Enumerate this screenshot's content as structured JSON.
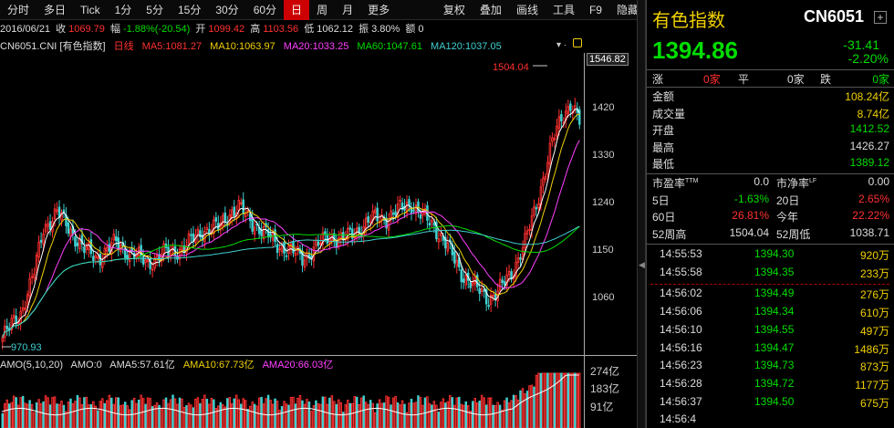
{
  "toolbar": {
    "items": [
      "分时",
      "多日",
      "Tick",
      "1分",
      "5分",
      "15分",
      "30分",
      "60分",
      "日",
      "周",
      "月",
      "更多"
    ],
    "active_index": 8,
    "right_items": [
      "复权",
      "叠加",
      "画线",
      "工具",
      "F9",
      "隐藏"
    ]
  },
  "info": {
    "date": "2016/06/21",
    "close_label": "收",
    "close": "1069.79",
    "change_label": "幅",
    "change": "-1.88%(-20.54)",
    "open_label": "开",
    "open": "1099.42",
    "high_label": "高",
    "high": "1103.56",
    "low_label": "低",
    "low": "1062.12",
    "amp_label": "振",
    "amp": "3.80%",
    "vol_label": "额",
    "vol": "0"
  },
  "ma": {
    "title": "CN6051.CNI [有色指数]",
    "period": "日线",
    "ma5": "MA5:1081.27",
    "ma10": "MA10:1063.97",
    "ma20": "MA20:1033.25",
    "ma60": "MA60:1047.61",
    "ma120": "MA120:1037.05"
  },
  "colors": {
    "ma5": "#ffffff",
    "ma10": "#f0d000",
    "ma20": "#ff40ff",
    "ma60": "#00dd00",
    "ma120": "#40d0d0",
    "up": "#ff3030",
    "down": "#40d0d0"
  },
  "chart_labels": {
    "high_annot": "1504.04",
    "low_annot": "970.93",
    "top_value": "1546.82",
    "yticks": [
      "1420",
      "1330",
      "1240",
      "1150",
      "1060"
    ]
  },
  "amo": {
    "label": "AMO(5,10,20)",
    "amo": "AMO:0",
    "ama5": "AMA5:57.61亿",
    "ama10": "AMA10:67.73亿",
    "ama20": "AMA20:66.03亿",
    "yticks": [
      "274亿",
      "183亿",
      "91亿"
    ]
  },
  "panel": {
    "name": "有色指数",
    "code": "CN6051",
    "price": "1394.86",
    "change": "-31.41",
    "pct": "-2.20%",
    "adv": {
      "up_label": "涨",
      "up": "0家",
      "flat_label": "平",
      "flat": "0家",
      "down_label": "跌",
      "down": "0家"
    },
    "stats": [
      {
        "k": "金额",
        "v": "108.24亿",
        "c": "yellow"
      },
      {
        "k": "成交量",
        "v": "8.74亿",
        "c": "yellow"
      },
      {
        "k": "开盘",
        "v": "1412.52",
        "c": "green"
      },
      {
        "k": "最高",
        "v": "1426.27",
        "c": "white"
      },
      {
        "k": "最低",
        "v": "1389.12",
        "c": "green"
      }
    ],
    "ratios": [
      {
        "k1": "市盈率",
        "sup1": "TTM",
        "v1": "0.0",
        "c1": "white",
        "k2": "市净率",
        "sup2": "LF",
        "v2": "0.00",
        "c2": "white"
      },
      {
        "k1": "5日",
        "v1": "-1.63%",
        "c1": "green",
        "k2": "20日",
        "v2": "2.65%",
        "c2": "red"
      },
      {
        "k1": "60日",
        "v1": "26.81%",
        "c1": "red",
        "k2": "今年",
        "v2": "22.22%",
        "c2": "red"
      },
      {
        "k1": "52周高",
        "v1": "1504.04",
        "c1": "white",
        "k2": "52周低",
        "v2": "1038.71",
        "c2": "white"
      }
    ],
    "ticks": [
      {
        "t": "14:55:53",
        "p": "1394.30",
        "v": "920万"
      },
      {
        "t": "14:55:58",
        "p": "1394.35",
        "v": "233万"
      },
      {
        "t": "14:56:02",
        "p": "1394.49",
        "v": "276万"
      },
      {
        "t": "14:56:06",
        "p": "1394.34",
        "v": "610万"
      },
      {
        "t": "14:56:10",
        "p": "1394.55",
        "v": "497万"
      },
      {
        "t": "14:56:16",
        "p": "1394.47",
        "v": "1486万"
      },
      {
        "t": "14:56:23",
        "p": "1394.73",
        "v": "873万"
      },
      {
        "t": "14:56:28",
        "p": "1394.72",
        "v": "1177万"
      },
      {
        "t": "14:56:37",
        "p": "1394.50",
        "v": "675万"
      },
      {
        "t": "14:56:4",
        "p": "",
        "v": ""
      }
    ]
  }
}
